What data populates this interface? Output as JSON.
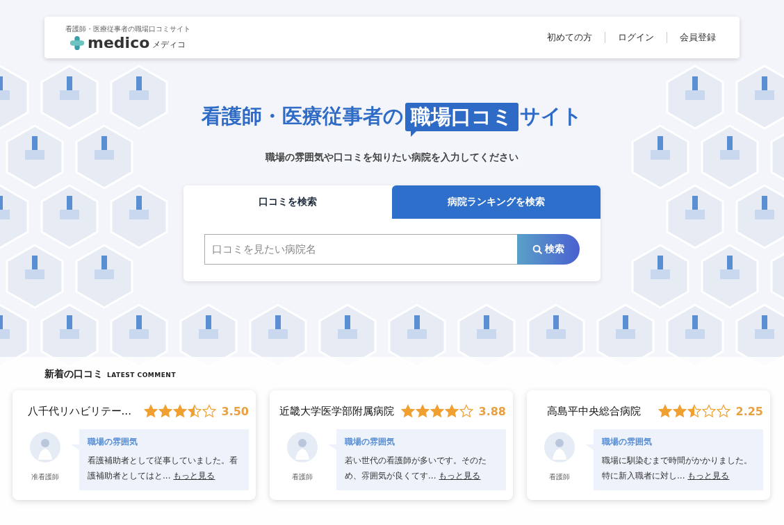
{
  "header": {
    "tagline": "看護師・医療従事者の職場口コミサイト",
    "logo_text": "medico",
    "logo_kana": "メディコ",
    "nav": [
      "初めての方",
      "ログイン",
      "会員登録"
    ]
  },
  "hero": {
    "headline_before": "看護師・医療従事者の",
    "headline_highlight": "職場口コミ",
    "headline_after": "サイト",
    "subtitle": "職場の雰囲気や口コミを知りたい病院を入力してください"
  },
  "search": {
    "tabs": [
      {
        "label": "口コミを検索",
        "selected": true
      },
      {
        "label": "病院ランキングを検索",
        "selected": false
      }
    ],
    "placeholder": "口コミを見たい病院名",
    "button": "検索"
  },
  "latest": {
    "title": "新着の口コミ",
    "subtitle": "LATEST COMMENT",
    "cards": [
      {
        "hospital": "八千代リハビリテー...",
        "stars": 3.5,
        "score": "3.50",
        "role": "准看護師",
        "category": "職場の雰囲気",
        "text": "看護補助者として従事していました。看護補助者としてはと...",
        "more": "もっと見る"
      },
      {
        "hospital": "近畿大学医学部附属病院",
        "stars": 4,
        "score": "3.88",
        "role": "看護師",
        "category": "職場の雰囲気",
        "text": "若い世代の看護師が多いです。そのため、雰囲気が良くてす...",
        "more": "もっと見る"
      },
      {
        "hospital": "高島平中央総合病院",
        "stars": 2.5,
        "score": "2.25",
        "role": "看護師",
        "category": "職場の雰囲気",
        "text": "職場に馴染むまで時間がかかりました。特に新入職者に対し...",
        "more": "もっと見る"
      }
    ]
  }
}
